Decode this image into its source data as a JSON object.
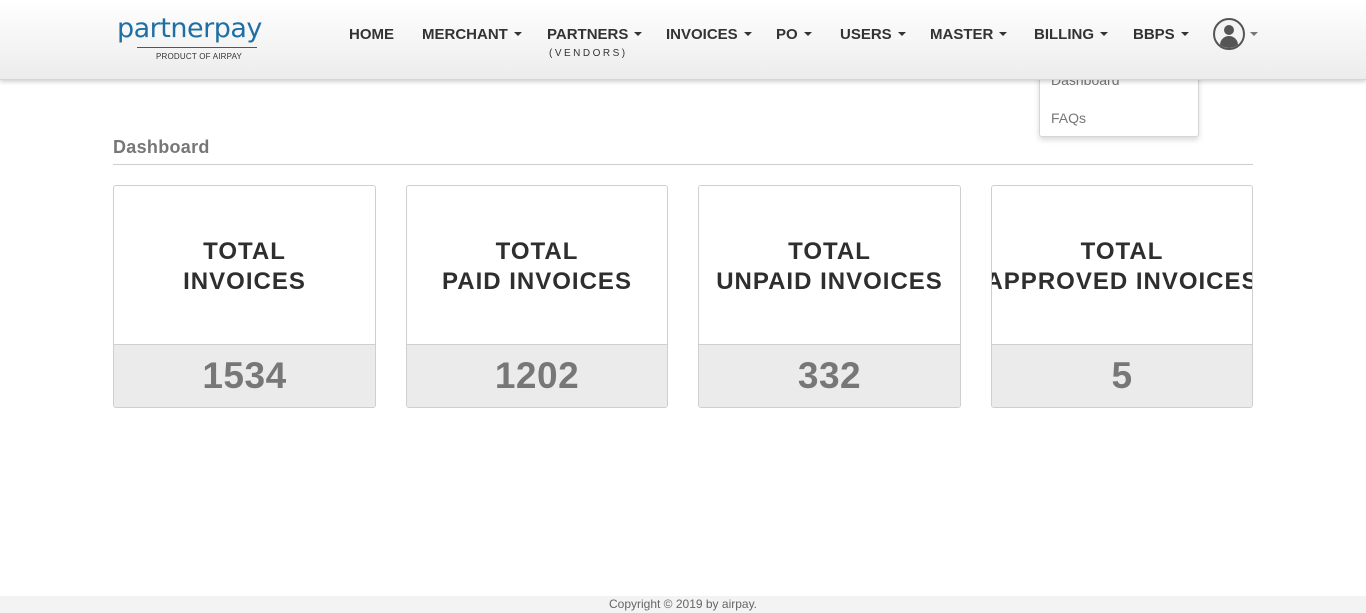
{
  "brand": {
    "logo_text": "partnerpay",
    "tagline": "PRODUCT OF AIRPAY"
  },
  "nav": {
    "items": [
      {
        "label": "HOME",
        "has_dropdown": false
      },
      {
        "label": "MERCHANT",
        "has_dropdown": true
      },
      {
        "label": "PARTNERS",
        "has_dropdown": true,
        "sublabel": "(VENDORS)"
      },
      {
        "label": "INVOICES",
        "has_dropdown": true
      },
      {
        "label": "PO",
        "has_dropdown": true
      },
      {
        "label": "USERS",
        "has_dropdown": true
      },
      {
        "label": "MASTER",
        "has_dropdown": true
      },
      {
        "label": "BILLING",
        "has_dropdown": true
      },
      {
        "label": "BBPS",
        "has_dropdown": true
      }
    ],
    "user_menu_icon": "user-avatar-icon"
  },
  "dropdown_menu": {
    "items": [
      "Dashboard",
      "FAQs"
    ]
  },
  "dashboard": {
    "title": "Dashboard",
    "cards": [
      {
        "line1": "TOTAL",
        "line2": "INVOICES",
        "value": "1534"
      },
      {
        "line1": "TOTAL",
        "line2": "PAID INVOICES",
        "value": "1202"
      },
      {
        "line1": "TOTAL",
        "line2": "UNPAID INVOICES",
        "value": "332"
      },
      {
        "line1": "TOTAL",
        "line2": "APPROVED INVOICES",
        "value": "5"
      }
    ]
  },
  "footer": {
    "copyright": "Copyright © 2019 by airpay."
  },
  "colors": {
    "brand_blue": "#1f6fa3",
    "card_footer_bg": "#ebebeb",
    "value_text": "#777777"
  }
}
